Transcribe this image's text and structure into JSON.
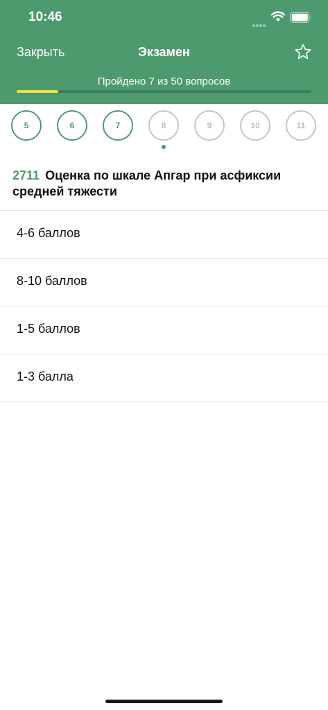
{
  "status_bar": {
    "time": "10:46"
  },
  "nav": {
    "close_label": "Закрыть",
    "title": "Экзамен",
    "star_icon": "star-outline-icon"
  },
  "progress": {
    "text": "Пройдено 7 из 50 вопросов",
    "completed": 7,
    "total": 50
  },
  "question_numbers": [
    {
      "label": "5",
      "status": "done"
    },
    {
      "label": "6",
      "status": "done"
    },
    {
      "label": "7",
      "status": "done"
    },
    {
      "label": "8",
      "status": "pending"
    },
    {
      "label": "9",
      "status": "pending"
    },
    {
      "label": "10",
      "status": "pending"
    },
    {
      "label": "11",
      "status": "pending"
    }
  ],
  "question": {
    "number": "2711",
    "text": "Оценка по шкале Апгар при асфиксии средней тяжести"
  },
  "answers": [
    "4-6 баллов",
    "8-10 баллов",
    "1-5 баллов",
    "1-3 балла"
  ],
  "colors": {
    "accent": "#4e9a6f",
    "progress_fill": "#f1de3f",
    "pending": "#c4c4c4"
  }
}
